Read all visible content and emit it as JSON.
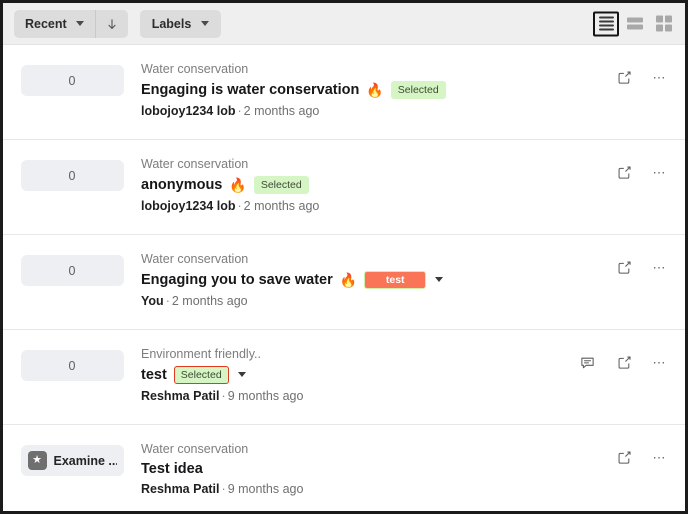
{
  "toolbar": {
    "sort_label": "Recent",
    "sort_direction_icon": "arrow-down-icon",
    "labels_label": "Labels",
    "view_modes": [
      {
        "name": "list-view",
        "icon": "list-view-icon",
        "active": true
      },
      {
        "name": "card-view",
        "icon": "card-view-icon",
        "active": false
      },
      {
        "name": "grid-view",
        "icon": "grid-view-icon",
        "active": false
      }
    ]
  },
  "rows": [
    {
      "left_type": "count",
      "count": "0",
      "category": "Water conservation",
      "title": "Engaging is water conservation",
      "fire": "🔥",
      "badge": {
        "type": "green",
        "text": "Selected"
      },
      "author": "lobojoy1234 lob",
      "separator": "·",
      "when": "2 months ago",
      "has_comment_icon": false
    },
    {
      "left_type": "count",
      "count": "0",
      "category": "Water conservation",
      "title": "anonymous",
      "fire": "🔥",
      "badge": {
        "type": "green",
        "text": "Selected"
      },
      "author": "lobojoy1234 lob",
      "separator": "·",
      "when": "2 months ago",
      "has_comment_icon": false
    },
    {
      "left_type": "count",
      "count": "0",
      "category": "Water conservation",
      "title": "Engaging you to save water",
      "fire": "🔥",
      "badge": {
        "type": "orange",
        "text": "test"
      },
      "author": "You",
      "separator": "·",
      "when": "2 months ago",
      "has_comment_icon": false
    },
    {
      "left_type": "count",
      "count": "0",
      "category": "Environment friendly..",
      "title": "test",
      "fire": "",
      "badge": {
        "type": "green-outlined",
        "text": "Selected"
      },
      "author": "Reshma Patil",
      "separator": "·",
      "when": "9 months ago",
      "has_comment_icon": true
    },
    {
      "left_type": "status",
      "status_text": "Examine ...",
      "status_icon": "star-icon",
      "category": "Water conservation",
      "title": "Test idea",
      "fire": "",
      "badge": null,
      "author": "Reshma Patil",
      "separator": "·",
      "when": "9 months ago",
      "has_comment_icon": false
    }
  ],
  "colors": {
    "toolbar_bg": "#efefef",
    "button_bg": "#dcdcdc",
    "count_pill_bg": "#edeff3",
    "badge_green_bg": "#d6f5c4",
    "badge_orange_bg": "#fa7557",
    "badge_outline_red": "#e03b1e",
    "divider": "#e8e8e8"
  }
}
